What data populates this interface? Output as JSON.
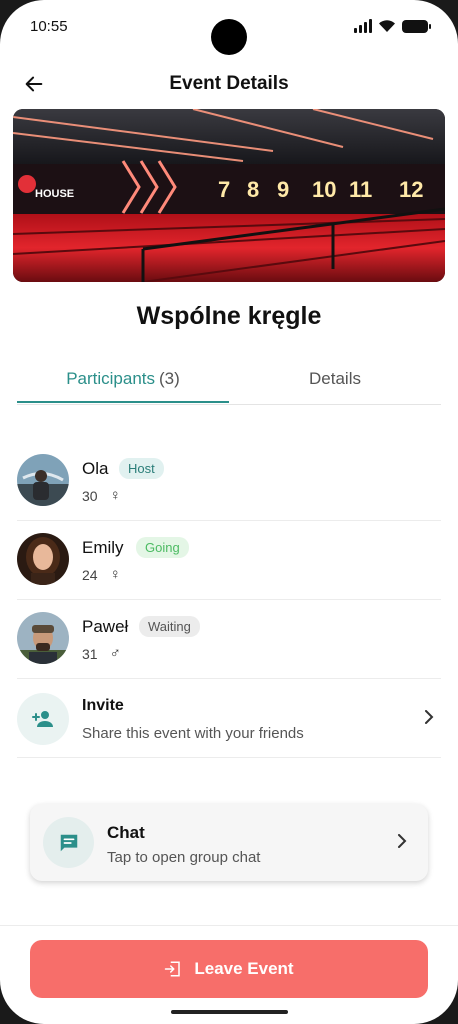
{
  "status_bar": {
    "time": "10:55"
  },
  "header": {
    "title": "Event Details"
  },
  "banner": {
    "sign_text": "HOUSE",
    "lane_numbers": [
      "7",
      "8",
      "9",
      "10",
      "11",
      "12"
    ]
  },
  "event": {
    "title": "Wspólne kręgle"
  },
  "tabs": [
    {
      "label": "Participants",
      "count": "(3)"
    },
    {
      "label": "Details"
    }
  ],
  "participants": [
    {
      "name": "Ola",
      "badge": "Host",
      "age": "30",
      "gender_symbol": "♀"
    },
    {
      "name": "Emily",
      "badge": "Going",
      "age": "24",
      "gender_symbol": "♀"
    },
    {
      "name": "Paweł",
      "badge": "Waiting",
      "age": "31",
      "gender_symbol": "♂"
    }
  ],
  "invite": {
    "title": "Invite",
    "subtitle": "Share this event with your friends"
  },
  "chat": {
    "title": "Chat",
    "subtitle": "Tap to open group chat"
  },
  "leave": {
    "label": "Leave Event"
  },
  "colors": {
    "accent": "#2b8f8a",
    "leave": "#f76e6a",
    "host_badge": "#e1f1f0",
    "going_badge": "#e4f6e6",
    "waiting_badge": "#ececec"
  }
}
